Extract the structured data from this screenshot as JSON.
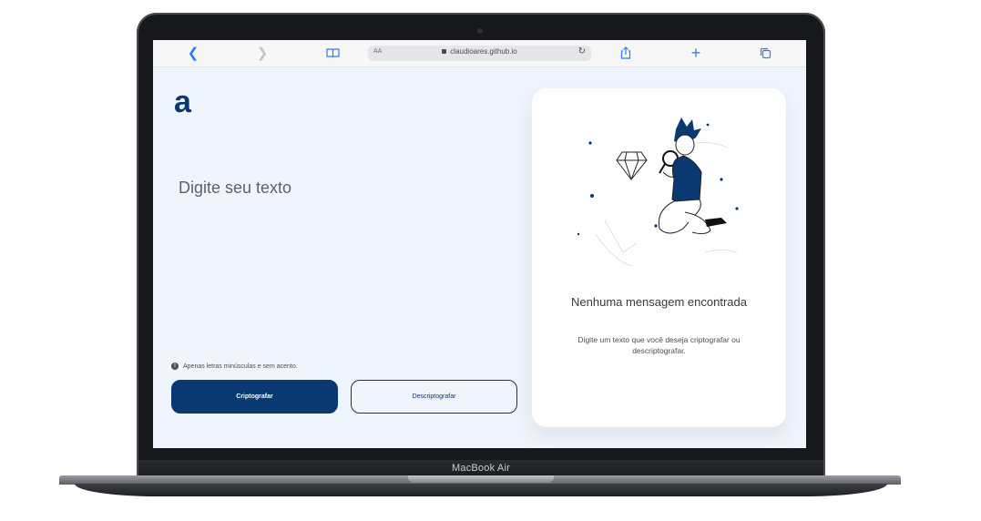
{
  "device": {
    "brand_label": "MacBook Air"
  },
  "browser": {
    "address": {
      "text_size_label": "AA",
      "url": "claudioares.github.io"
    },
    "icons": [
      "back-icon",
      "forward-icon",
      "bookmarks-icon",
      "reload-icon",
      "share-icon",
      "new-tab-icon",
      "tabs-icon"
    ]
  },
  "app": {
    "logo": "a",
    "input": {
      "placeholder": "Digite seu texto",
      "value": ""
    },
    "hint": "Apenas letras minúsculas e sem acento.",
    "buttons": {
      "encrypt": "Criptografar",
      "decrypt": "Descriptografar"
    },
    "output": {
      "title": "Nenhuma mensagem encontrada",
      "text": "Digite um texto que você deseja criptografar ou descriptografar."
    }
  },
  "colors": {
    "primary": "#0a3871",
    "background": "#f0f4fc",
    "link_blue": "#2f7bf5"
  }
}
